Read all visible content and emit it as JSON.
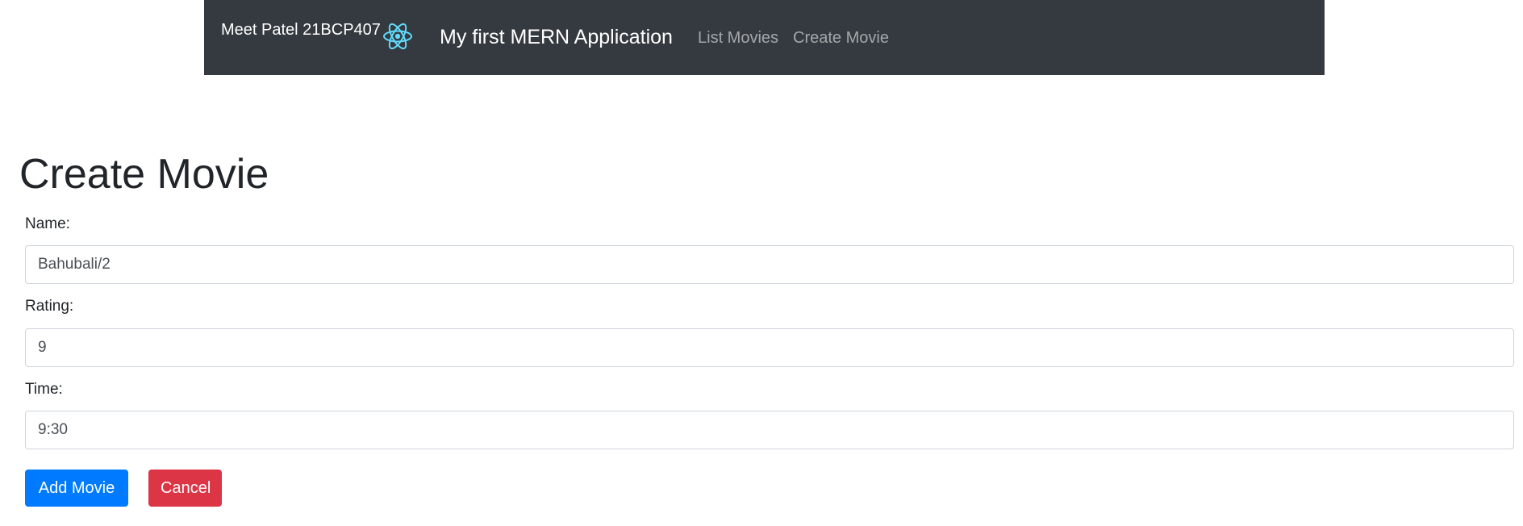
{
  "navbar": {
    "author": "Meet Patel 21BCP407",
    "logo_icon": "react-atom-icon",
    "title": "My first MERN Application",
    "links": [
      "List Movies",
      "Create Movie"
    ],
    "background_color": "#343a40",
    "logo_color": "#61dafb"
  },
  "page": {
    "title": "Create Movie"
  },
  "form": {
    "name_label": "Name:",
    "name_value": "Bahubali/2",
    "rating_label": "Rating:",
    "rating_value": "9",
    "time_label": "Time:",
    "time_value": "9:30",
    "submit_label": "Add Movie",
    "cancel_label": "Cancel",
    "submit_color": "#007bff",
    "cancel_color": "#dc3545"
  }
}
